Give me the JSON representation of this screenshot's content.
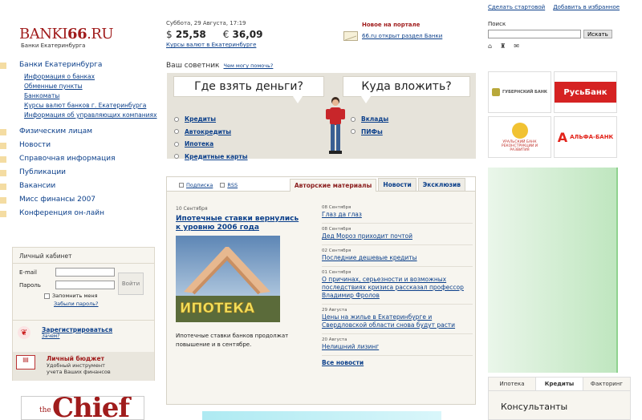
{
  "top_links": [
    "Сделать стартовой",
    "Добавить в избранное"
  ],
  "logo": {
    "brand_prefix": "BANKI",
    "brand_number": "66",
    "brand_suffix": ".RU",
    "tagline": "Банки Екатеринбурга"
  },
  "rates": {
    "date": "Суббота, 29 Августа, 17:19",
    "usd_symbol": "$",
    "usd": "25,58",
    "eur_symbol": "€",
    "eur": "36,09",
    "link": "Курсы валют в Екатеринбурге"
  },
  "news": {
    "title": "Новое на портале",
    "item": "66.ru открыт раздел Банки"
  },
  "search": {
    "label": "Поиск",
    "button": "Искать",
    "value": ""
  },
  "nav": {
    "sections": [
      {
        "label": "Банки Екатеринбурга",
        "sub": [
          "Информация о банках",
          "Обменные пункты",
          "Банкоматы",
          "Курсы валют банков г. Екатеринбурга",
          "Информация об управляющих компаниях"
        ]
      },
      {
        "label": "Физическим лицам"
      },
      {
        "label": "Новости"
      },
      {
        "label": "Справочная информация"
      },
      {
        "label": "Публикации"
      },
      {
        "label": "Вакансии"
      },
      {
        "label": "Мисс финансы 2007"
      },
      {
        "label": "Конференция он-лайн"
      }
    ]
  },
  "cabinet": {
    "title": "Личный кабинет",
    "email_label": "E-mail",
    "password_label": "Пароль",
    "login_button": "Войти",
    "remember": "Запомнить меня",
    "forgot": "Забыли пароль?",
    "register": "Зарегистрироваться",
    "why": "Зачем?",
    "budget_title": "Личный бюджет",
    "budget_desc1": "Удобный инструмент",
    "budget_desc2": "учета Ваших финансов"
  },
  "advisor": {
    "title": "Ваш советник",
    "help": "Чем могу помочь?",
    "left_question": "Где взять деньги?",
    "right_question": "Куда вложить?",
    "left_items": [
      "Кредиты",
      "Автокредиты",
      "Ипотека",
      "Кредитные карты"
    ],
    "right_items": [
      "Вклады",
      "ПИФы"
    ]
  },
  "banks": [
    {
      "name": "ГУБЕРНСКИЙ БАНК",
      "color": "#9a8f2a"
    },
    {
      "name": "РусьБанк",
      "color": "#d52222"
    },
    {
      "name": "УРАЛЬСКИЙ БАНК РЕКОНСТРУКЦИИ И РАЗВИТИЯ",
      "color": "#c0302a"
    },
    {
      "name": "АЛЬФА-БАНК",
      "color": "#e2231a"
    }
  ],
  "articles": {
    "options": [
      "Подписка",
      "RSS"
    ],
    "tabs": [
      "Авторские материалы",
      "Новости",
      "Эксклюзив"
    ],
    "active_tab": "Авторские материалы",
    "feature": {
      "date": "10 Сентября",
      "title": "Ипотечные ставки вернулись к уровню 2006 года",
      "image_text": "ИПОТЕКА",
      "desc": "Ипотечные ставки банков продолжат повышение и в сентябре."
    },
    "items": [
      {
        "date": "08 Сентября",
        "title": "Глаз да глаз"
      },
      {
        "date": "08 Сентября",
        "title": "Дед Мороз приходит почтой"
      },
      {
        "date": "02 Сентября",
        "title": "Последние дешевые кредиты"
      },
      {
        "date": "01 Сентября",
        "title": "О причинах, серьезности и возможных последствиях кризиса рассказал профессор Владимир Фролов"
      },
      {
        "date": "29 Августа",
        "title": "Цены на жилье в Екатеринбурге и Свердловской области снова будут расти"
      },
      {
        "date": "20 Августа",
        "title": "Нелишний лизинг"
      }
    ],
    "all_news": "Все новости"
  },
  "bottom_tabs": {
    "tabs": [
      "Ипотека",
      "Кредиты",
      "Факторинг"
    ],
    "active": "Кредиты",
    "body": "Консультанты"
  },
  "chief": {
    "small": "the",
    "big": "Chief"
  }
}
